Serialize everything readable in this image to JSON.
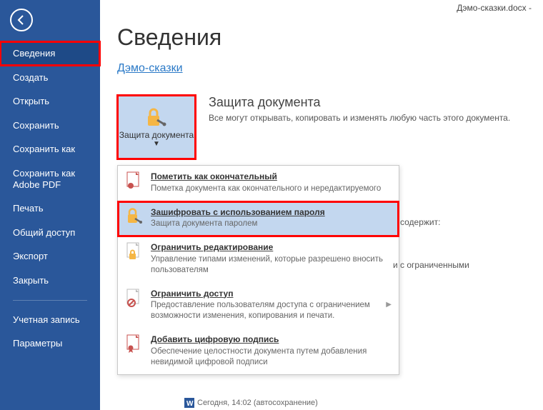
{
  "title_bar": "Дэмо-сказки.docx -",
  "sidebar": {
    "items": [
      "Сведения",
      "Создать",
      "Открыть",
      "Сохранить",
      "Сохранить как",
      "Сохранить как Adobe PDF",
      "Печать",
      "Общий доступ",
      "Экспорт",
      "Закрыть"
    ],
    "footer_items": [
      "Учетная запись",
      "Параметры"
    ]
  },
  "main": {
    "heading": "Сведения",
    "doc_link": "Дэмо-сказки",
    "protect": {
      "button_label": "Защита документа",
      "title": "Защита документа",
      "desc": "Все могут открывать, копировать и изменять любую часть этого документа."
    },
    "side_text_1": "содержит:",
    "side_text_2": "и с ограниченными",
    "menu": [
      {
        "title": "Пометить как окончательный",
        "desc": "Пометка документа как окончательного и нередактируемого"
      },
      {
        "title": "Зашифровать с использованием пароля",
        "desc": "Защита документа паролем"
      },
      {
        "title": "Ограничить редактирование",
        "desc": "Управление типами изменений, которые разрешено вносить пользователям"
      },
      {
        "title": "Ограничить доступ",
        "desc": "Предоставление пользователям доступа с ограничением возможности изменения, копирования и печати."
      },
      {
        "title": "Добавить цифровую подпись",
        "desc": "Обеспечение целостности документа путем добавления невидимой цифровой подписи"
      }
    ]
  },
  "status": "Сегодня, 14:02 (автосохранение)"
}
